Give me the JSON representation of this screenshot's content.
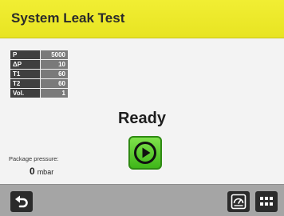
{
  "header": {
    "title": "System Leak Test"
  },
  "params": [
    {
      "label": "P",
      "value": "5000"
    },
    {
      "label": "ΔP",
      "value": "10"
    },
    {
      "label": "T1",
      "value": "60"
    },
    {
      "label": "T2",
      "value": "60"
    },
    {
      "label": "Vol.",
      "value": "1"
    }
  ],
  "status": "Ready",
  "package": {
    "label": "Package pressure:",
    "value": "0",
    "unit": "mbar"
  },
  "icons": {
    "back": "back-arrow-icon",
    "start": "play-icon",
    "gauge": "gauge-icon",
    "menu": "grid-menu-icon"
  },
  "colors": {
    "header": "#ebe72a",
    "start": "#4cc11e",
    "footer": "#a5a5a5"
  }
}
